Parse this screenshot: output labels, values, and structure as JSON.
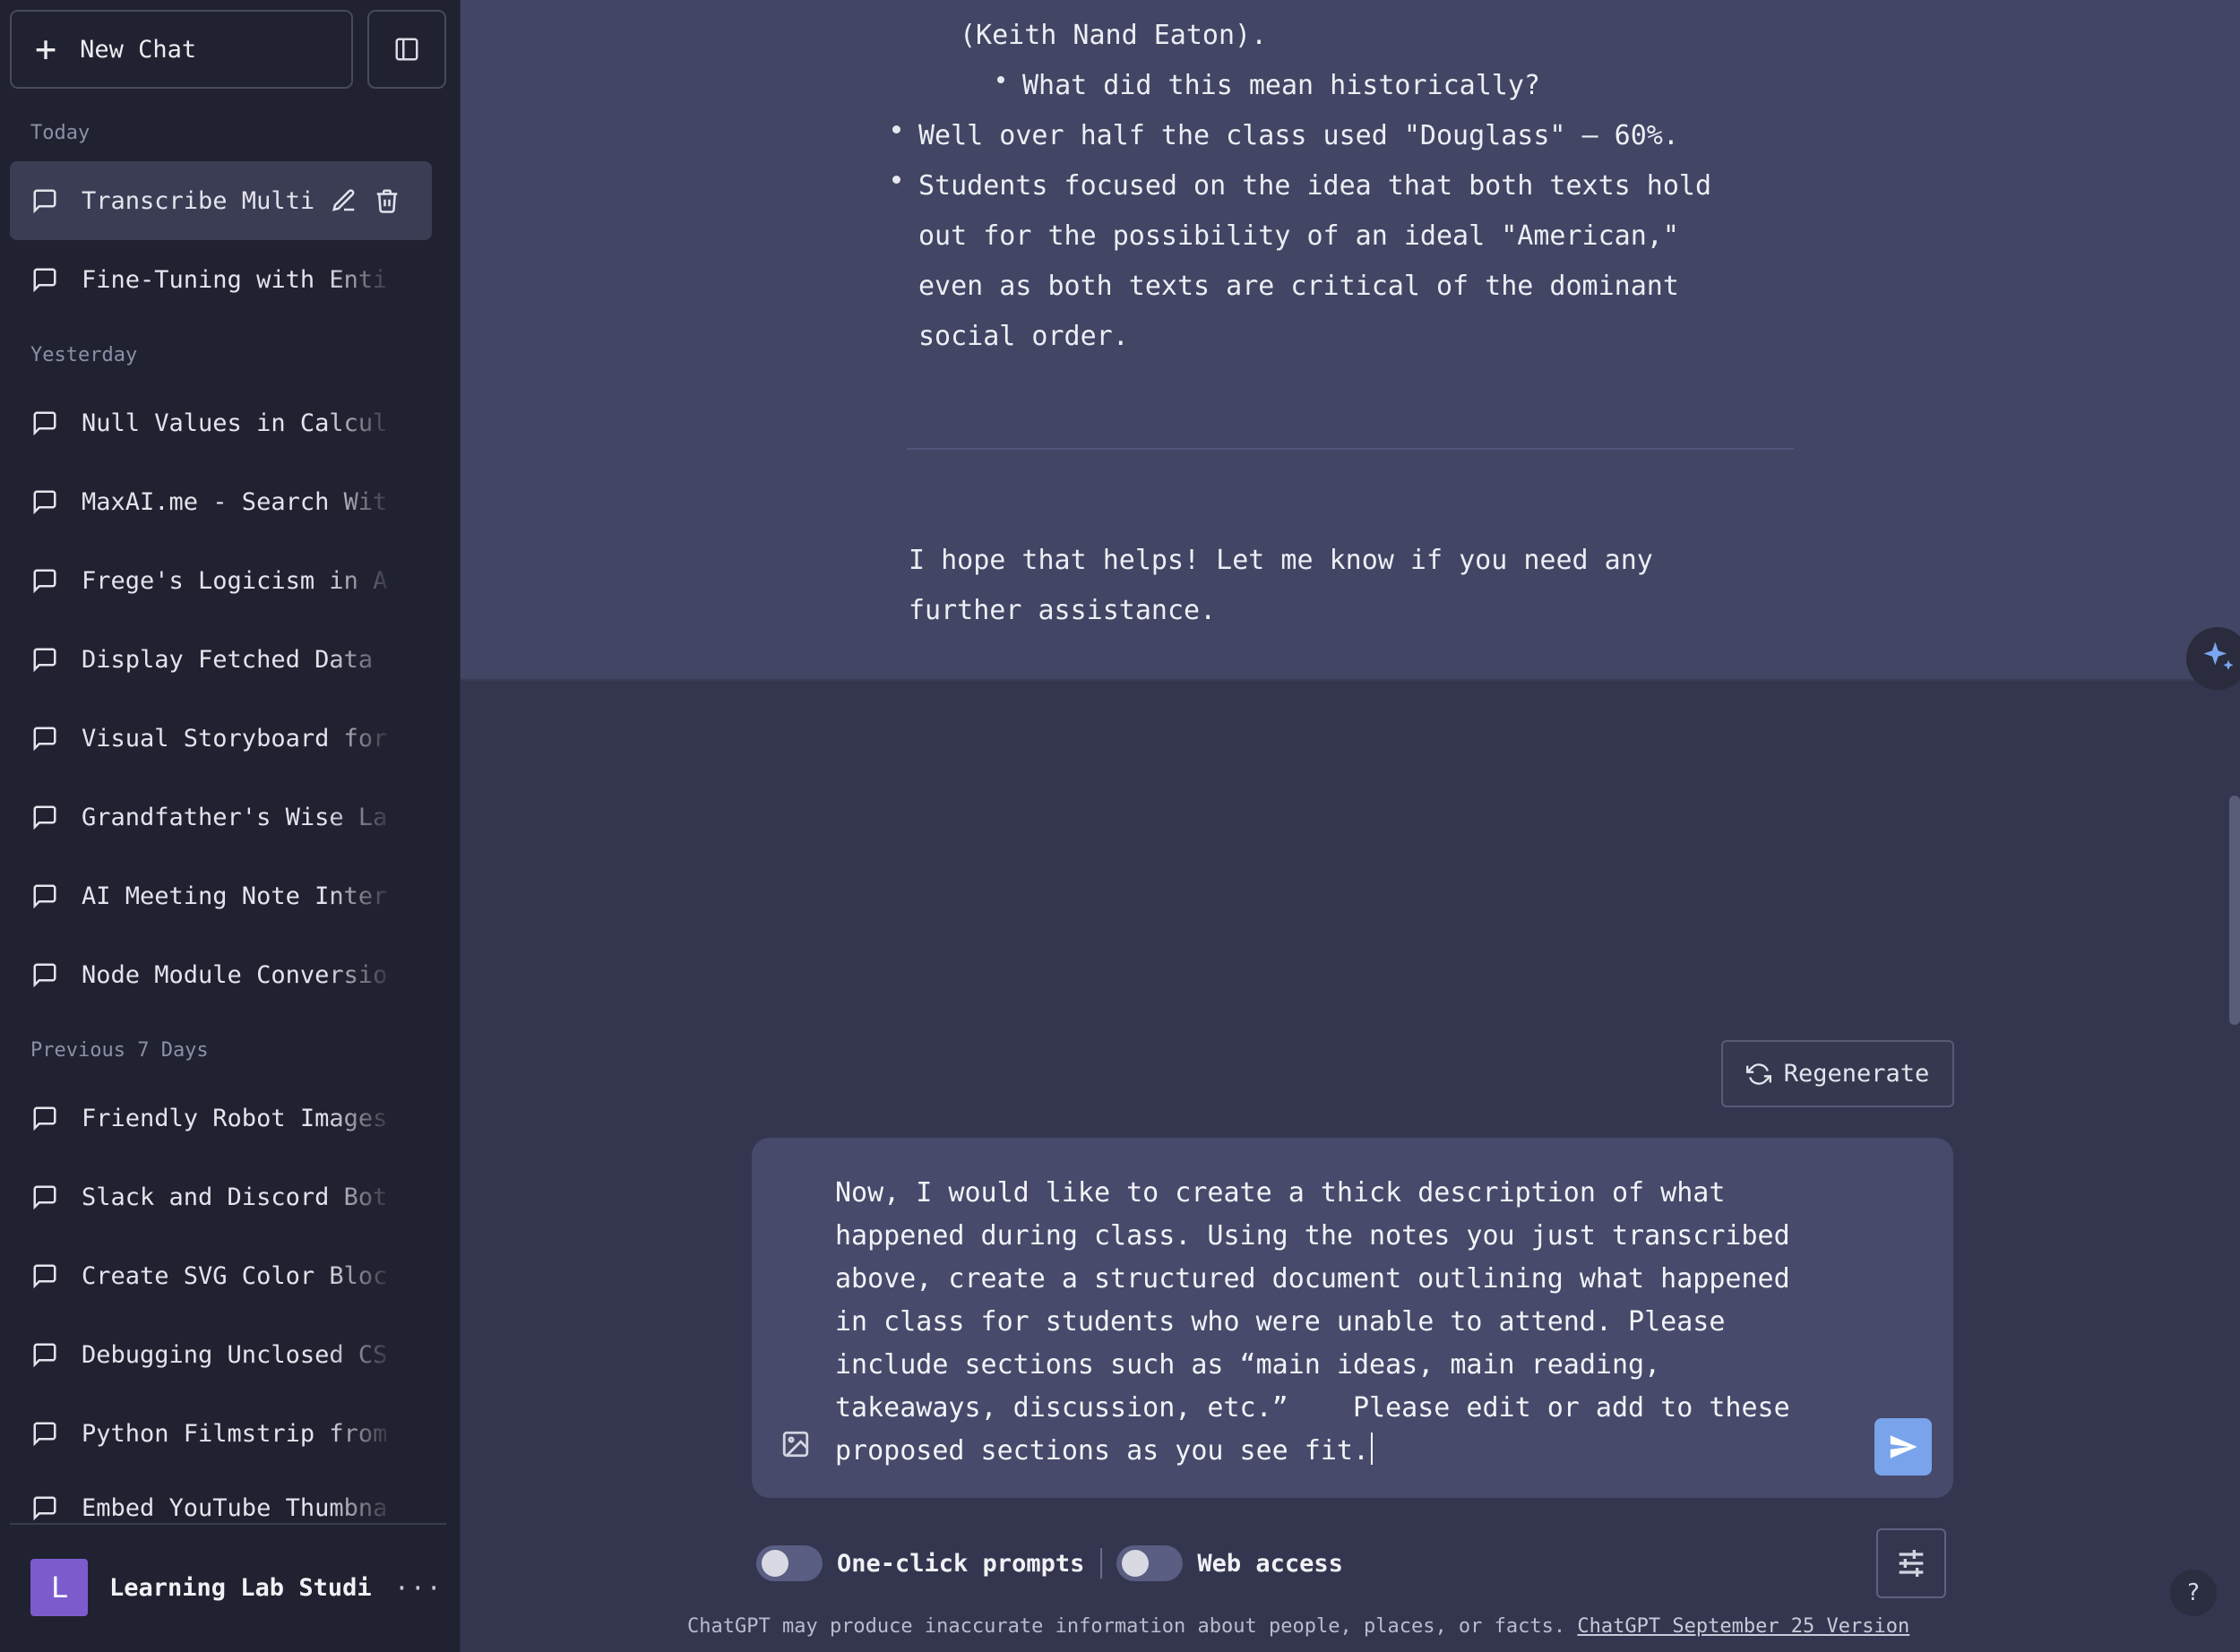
{
  "sidebar": {
    "new_chat_label": "New Chat",
    "sections": {
      "today": "Today",
      "yesterday": "Yesterday",
      "previous_7_days": "Previous 7 Days"
    },
    "today_items": [
      {
        "title": "Transcribe Multi"
      },
      {
        "title": "Fine-Tuning with Enti"
      }
    ],
    "yesterday_items": [
      {
        "title": "Null Values in Calcul"
      },
      {
        "title": "MaxAI.me - Search Wit"
      },
      {
        "title": "Frege's Logicism in A"
      },
      {
        "title": "Display Fetched Data"
      },
      {
        "title": "Visual Storyboard for"
      },
      {
        "title": "Grandfather's Wise La"
      },
      {
        "title": "AI Meeting Note Inter"
      },
      {
        "title": "Node Module Conversio"
      }
    ],
    "previous_items": [
      {
        "title": "Friendly Robot Images"
      },
      {
        "title": "Slack and Discord Bot"
      },
      {
        "title": "Create SVG Color Bloc"
      },
      {
        "title": "Debugging Unclosed CS"
      },
      {
        "title": "Python Filmstrip from"
      },
      {
        "title": "Embed YouTube Thumbna"
      }
    ],
    "user": {
      "initial": "L",
      "name": "Learning Lab Studi",
      "more": "···"
    }
  },
  "message": {
    "lines": [
      "(Keith Nand Eaton).",
      "What did this mean historically?",
      "Well over half the class used \"Douglass\" — 60%.",
      "Students focused on the idea that both texts hold",
      "out for the possibility of an ideal \"American,\"",
      "even as both texts are critical of the dominant",
      "social order.",
      "I hope that helps! Let me know if you need any",
      "further assistance."
    ]
  },
  "regenerate_label": "Regenerate",
  "composer": {
    "text": "Now, I would like to create a thick description of what\nhappened during class. Using the notes you just transcribed\nabove, create a structured document outlining what happened\nin class for students who were unable to attend. Please\ninclude sections such as “main ideas, main reading,\ntakeaways, discussion, etc.”    Please edit or add to these\nproposed sections as you see fit."
  },
  "controls": {
    "one_click_prompts": "One-click prompts",
    "web_access": "Web access"
  },
  "footer": {
    "disclaimer": "ChatGPT may produce inaccurate information about people, places, or facts.",
    "version_link": "ChatGPT September 25 Version"
  },
  "help_label": "?"
}
